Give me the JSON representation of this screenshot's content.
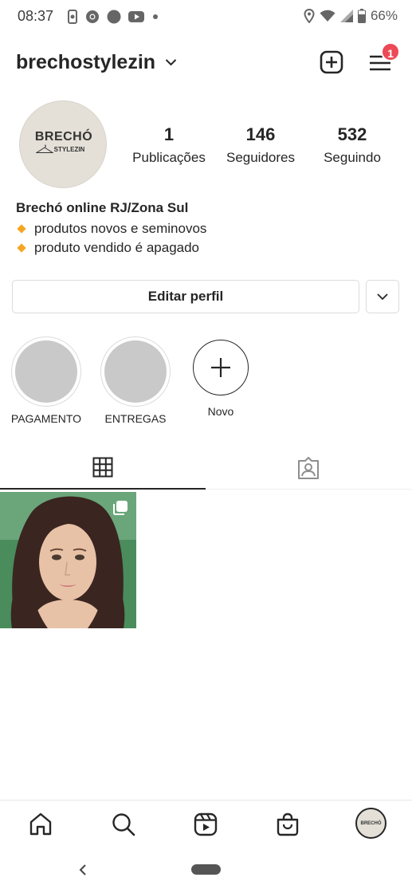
{
  "status_bar": {
    "time": "08:37",
    "battery": "66%",
    "icons_left": [
      "phone-screen-icon",
      "chrome-icon",
      "circle-icon",
      "youtube-icon",
      "dot-icon"
    ],
    "icons_right": [
      "location-icon",
      "wifi-icon",
      "signal-icon",
      "battery-icon"
    ]
  },
  "header": {
    "username": "brechostylezin",
    "notification_count": "1"
  },
  "profile": {
    "avatar_title": "BRECHÓ",
    "avatar_subtitle": "STYLEZIN",
    "stats": [
      {
        "value": "1",
        "label": "Publicações"
      },
      {
        "value": "146",
        "label": "Seguidores"
      },
      {
        "value": "532",
        "label": "Seguindo"
      }
    ]
  },
  "bio": {
    "name": "Brechó online RJ/Zona Sul",
    "lines": [
      "produtos novos e seminovos",
      "produto vendido é apagado"
    ]
  },
  "actions": {
    "edit_profile": "Editar perfil"
  },
  "highlights": [
    {
      "label": "PAGAMENTO"
    },
    {
      "label": "ENTREGAS"
    },
    {
      "label": "Novo"
    }
  ],
  "tabs": [
    "grid-icon",
    "tagged-icon"
  ],
  "posts": [
    {
      "type": "carousel"
    }
  ],
  "bottom_nav": [
    "home-icon",
    "search-icon",
    "reels-icon",
    "shop-icon",
    "profile-avatar"
  ],
  "avatar_small_text": "BRECHÓ",
  "colors": {
    "badge": "#ed4956",
    "accent_diamond": "#f5a623",
    "text": "#262626",
    "border": "#dbdbdb"
  }
}
